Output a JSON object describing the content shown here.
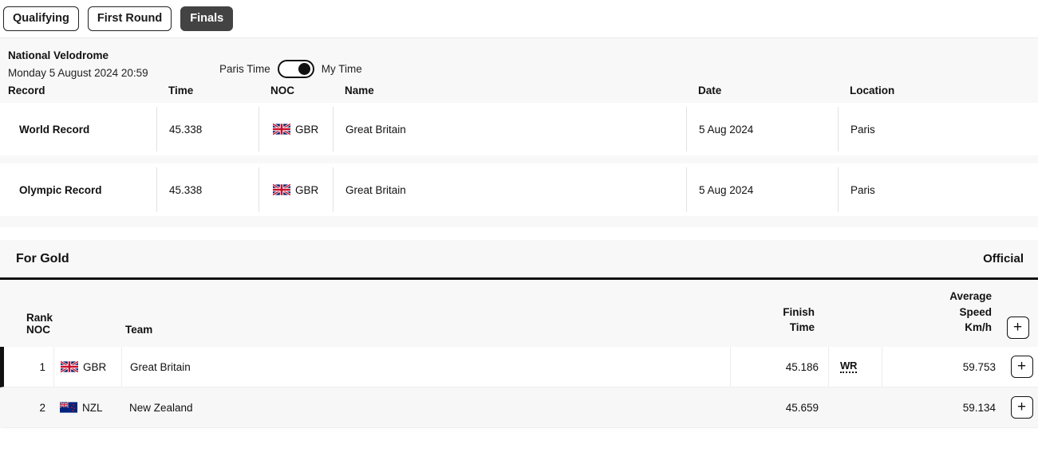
{
  "tabs": [
    {
      "label": "Qualifying",
      "active": false
    },
    {
      "label": "First Round",
      "active": false
    },
    {
      "label": "Finals",
      "active": true
    }
  ],
  "venue": {
    "name": "National Velodrome",
    "datetime": "Monday 5 August 2024 20:59",
    "time_toggle": {
      "left_label": "Paris Time",
      "right_label": "My Time",
      "state": "my-time"
    }
  },
  "records_table": {
    "columns": [
      "Record",
      "Time",
      "NOC",
      "Name",
      "Date",
      "Location"
    ],
    "rows": [
      {
        "record": "World Record",
        "time": "45.338",
        "noc": "GBR",
        "flag": "gbr-flag",
        "name": "Great Britain",
        "date": "5 Aug 2024",
        "location": "Paris"
      },
      {
        "record": "Olympic Record",
        "time": "45.338",
        "noc": "GBR",
        "flag": "gbr-flag",
        "name": "Great Britain",
        "date": "5 Aug 2024",
        "location": "Paris"
      }
    ]
  },
  "heat": {
    "title": "For Gold",
    "status": "Official"
  },
  "results_table": {
    "columns": {
      "rank_noc": "Rank NOC",
      "team": "Team",
      "finish_time_line1": "Finish",
      "finish_time_line2": "Time",
      "speed_line1": "Average",
      "speed_line2": "Speed",
      "speed_line3": "Km/h",
      "expand_all": "+"
    },
    "rows": [
      {
        "rank": "1",
        "noc": "GBR",
        "flag": "gbr-flag",
        "team": "Great Britain",
        "finish_time": "45.186",
        "badge": "WR",
        "speed": "59.753",
        "expand": "+"
      },
      {
        "rank": "2",
        "noc": "NZL",
        "flag": "nzl-flag",
        "team": "New Zealand",
        "finish_time": "45.659",
        "badge": "",
        "speed": "59.134",
        "expand": "+"
      }
    ]
  },
  "colors": {
    "page_bg": "#ffffff",
    "panel_bg": "#f8f8f8",
    "row_bg": "#ffffff",
    "alt_row_bg": "#f7f7f7",
    "active_tab_bg": "#434343",
    "text": "#111111",
    "rule": "#111111"
  }
}
